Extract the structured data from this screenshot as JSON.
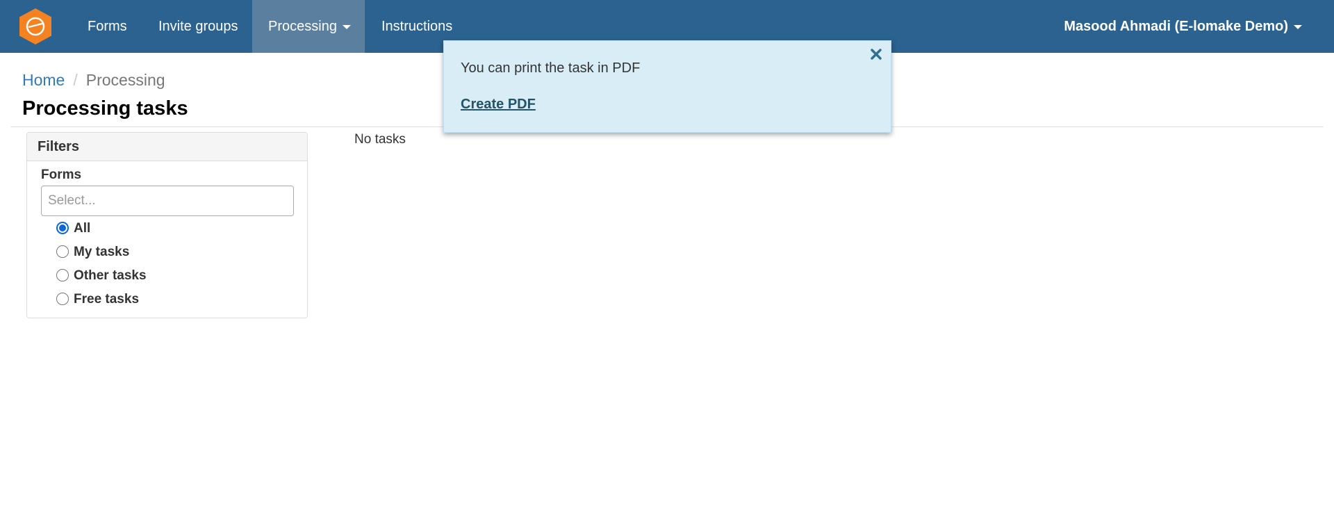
{
  "navbar": {
    "logo_icon": "elomake-hexagon-logo",
    "background_color": "#2b6290",
    "active_item_color": "#5b7f9e",
    "items": [
      {
        "label": "Forms"
      },
      {
        "label": "Invite groups"
      },
      {
        "label": "Processing",
        "dropdown": true,
        "active": true
      },
      {
        "label": "Instructions"
      }
    ],
    "user_menu_label": "Masood Ahmadi (E-lomake Demo)"
  },
  "breadcrumb": {
    "home": "Home",
    "separator": "/",
    "current": "Processing"
  },
  "page_title": "Processing tasks",
  "filters": {
    "heading": "Filters",
    "forms_label": "Forms",
    "select_placeholder": "Select...",
    "options": [
      {
        "label": "All",
        "checked": true
      },
      {
        "label": "My tasks",
        "checked": false
      },
      {
        "label": "Other tasks",
        "checked": false
      },
      {
        "label": "Free tasks",
        "checked": false
      }
    ]
  },
  "main": {
    "empty_text": "No tasks"
  },
  "popover": {
    "message": "You can print the task in PDF",
    "link_label": "Create PDF",
    "close_icon": "close-icon",
    "background_color": "#d9edf7"
  }
}
